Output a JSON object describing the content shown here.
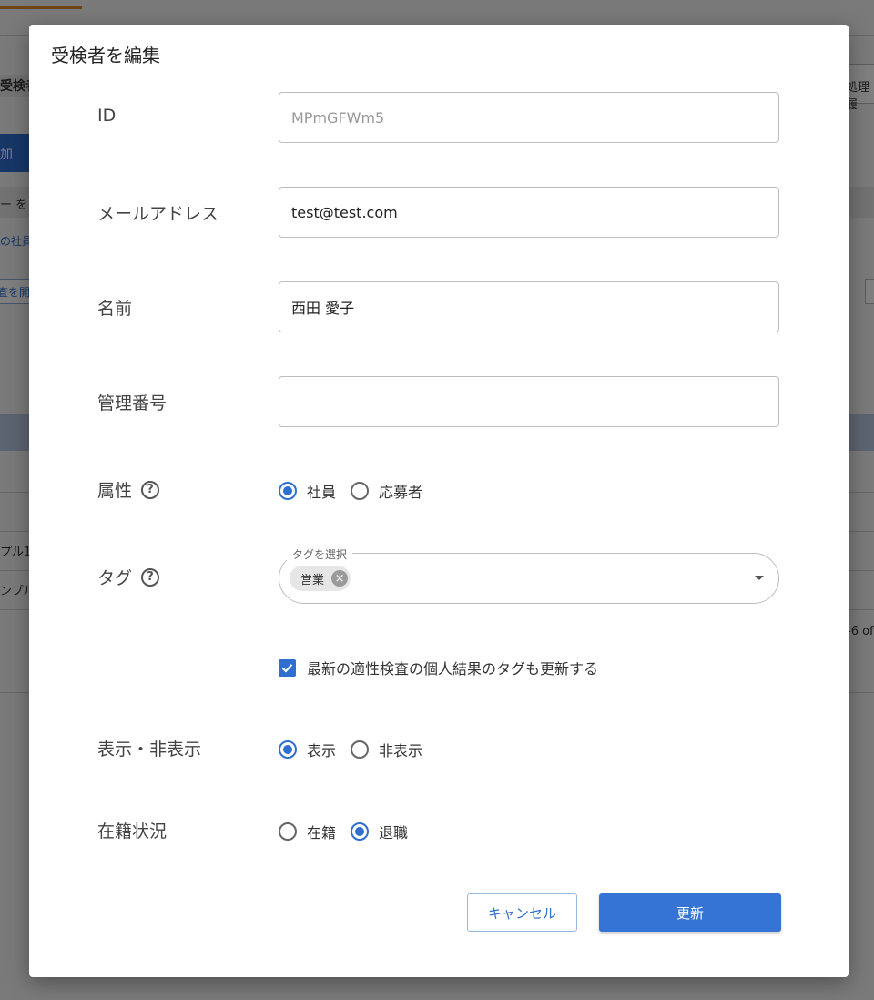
{
  "background": {
    "tab_label": "受検者",
    "add_button": "加",
    "filter_text": "ー を",
    "chip_text": "の社員",
    "action_text": "査を開",
    "right_tab": "処理履",
    "row1": "プル1",
    "row2": "ンプル",
    "pagination": "-6 of"
  },
  "dialog": {
    "title": "受検者を編集",
    "fields": {
      "id": {
        "label": "ID",
        "value": "MPmGFWm5"
      },
      "email": {
        "label": "メールアドレス",
        "value": "test@test.com"
      },
      "name": {
        "label": "名前",
        "value": "西田 愛子"
      },
      "management_number": {
        "label": "管理番号",
        "value": ""
      }
    },
    "attribute": {
      "label": "属性",
      "options": [
        {
          "label": "社員",
          "selected": true
        },
        {
          "label": "応募者",
          "selected": false
        }
      ]
    },
    "tags": {
      "label": "タグ",
      "legend": "タグを選択",
      "chips": [
        "営業"
      ]
    },
    "update_tags_checkbox": {
      "label": "最新の適性検査の個人結果のタグも更新する",
      "checked": true
    },
    "visibility": {
      "label": "表示・非表示",
      "options": [
        {
          "label": "表示",
          "selected": true
        },
        {
          "label": "非表示",
          "selected": false
        }
      ]
    },
    "employment_status": {
      "label": "在籍状況",
      "options": [
        {
          "label": "在籍",
          "selected": false
        },
        {
          "label": "退職",
          "selected": true
        }
      ]
    },
    "buttons": {
      "cancel": "キャンセル",
      "update": "更新"
    }
  },
  "colors": {
    "primary": "#3573d5",
    "accent_orange": "#e08a2c"
  }
}
